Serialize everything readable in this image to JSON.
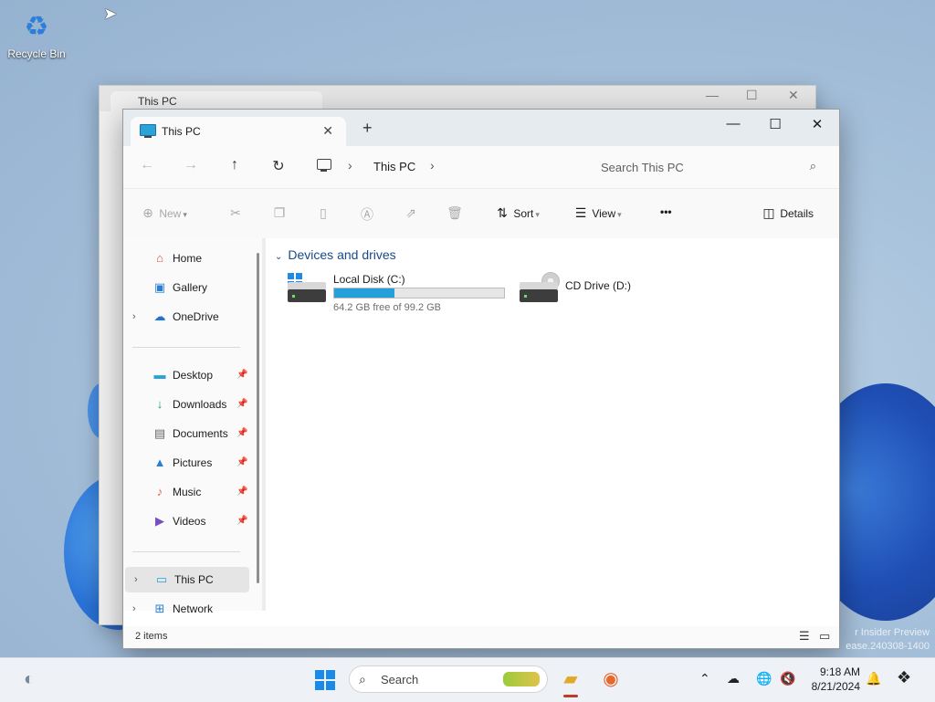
{
  "desktop": {
    "recycle_bin_label": "Recycle Bin",
    "watermark_line1": "r Insider Preview",
    "watermark_line2": "ease.240308-1400"
  },
  "back_window": {
    "tab_title": "This PC"
  },
  "window": {
    "tab_title": "This PC",
    "breadcrumb": [
      "This PC"
    ],
    "search_placeholder": "Search This PC",
    "toolbar": {
      "new_label": "New",
      "sort_label": "Sort",
      "view_label": "View",
      "more_label": "•••",
      "details_label": "Details"
    },
    "sidebar": {
      "items": [
        {
          "label": "Home",
          "icon": "home-icon"
        },
        {
          "label": "Gallery",
          "icon": "gallery-icon"
        },
        {
          "label": "OneDrive",
          "icon": "onedrive-icon"
        },
        {
          "label": "Desktop",
          "icon": "desktop-folder-icon"
        },
        {
          "label": "Downloads",
          "icon": "downloads-icon"
        },
        {
          "label": "Documents",
          "icon": "documents-icon"
        },
        {
          "label": "Pictures",
          "icon": "pictures-icon"
        },
        {
          "label": "Music",
          "icon": "music-icon"
        },
        {
          "label": "Videos",
          "icon": "videos-icon"
        },
        {
          "label": "This PC",
          "icon": "this-pc-icon"
        },
        {
          "label": "Network",
          "icon": "network-icon"
        }
      ]
    },
    "content": {
      "group_header": "Devices and drives",
      "drives": [
        {
          "name": "Local Disk (C:)",
          "free_text": "64.2 GB free of 99.2 GB",
          "used_fraction": 0.353
        },
        {
          "name": "CD Drive (D:)"
        }
      ]
    },
    "status": {
      "item_count": "2 items"
    }
  },
  "taskbar": {
    "search_placeholder": "Search",
    "time": "9:18 AM",
    "date": "8/21/2024"
  },
  "colors": {
    "accent": "#26a0da",
    "group_header": "#1a4a8a",
    "start_blue": "#1a8ae6"
  }
}
